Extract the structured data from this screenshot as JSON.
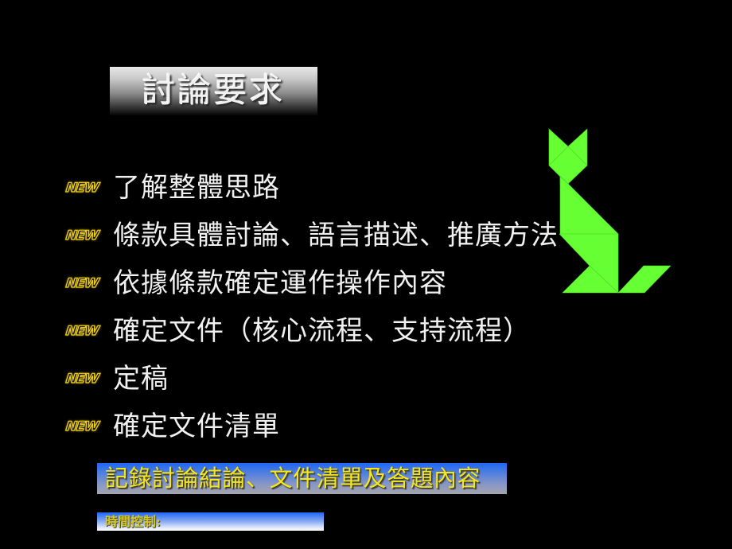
{
  "slide": {
    "title": "討論要求",
    "bullet_icon": "new-badge-icon",
    "bullet_icon_label": "NEW",
    "bullets": [
      {
        "text": "了解整體思路"
      },
      {
        "text": "條款具體討論、語言描述、推廣方法"
      },
      {
        "text": "依據條款確定運作操作內容"
      },
      {
        "text": "確定文件（核心流程、支持流程）"
      },
      {
        "text": "定稿"
      },
      {
        "text": "確定文件清單"
      }
    ],
    "conclusion_banner": "記錄討論結論、文件清單及答題內容",
    "time_banner": "時間控制:",
    "decoration": {
      "type": "tangram-cat-icon",
      "color": "#66ff33"
    },
    "colors": {
      "background": "#000000",
      "bullet_text": "#f0f0f0",
      "badge": "#f2d21a",
      "banner_text": "#f5e61a",
      "banner_blue": "#1f66f5"
    }
  }
}
